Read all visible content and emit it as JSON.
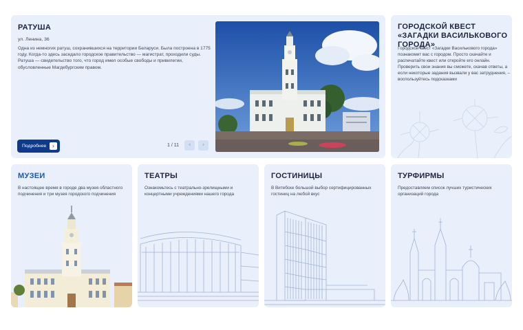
{
  "hero": {
    "title": "РАТУША",
    "address": "ул. Ленина, 36",
    "description": "Одна из немногих ратуш, сохранившихся на территории Беларуси. Была построена в 1775 году. Когда-то здесь заседало городское правительство — магистрат, проходили суды. Ратуша — свидетельство того, что город имел особые свободы и привилегии, обусловленные Магдебургским правом.",
    "more_label": "Подробнее",
    "more_icon": "arrow-right-icon",
    "pager": "1 / 11",
    "prev_icon": "chevron-left-icon",
    "next_icon": "chevron-right-icon"
  },
  "quest": {
    "title": "ГОРОДСКОЙ КВЕСТ «ЗАГАДКИ ВАСИЛЬКОВОГО ГОРОДА»",
    "description": "Городской квест «Загадки Василькового города» познакомит вас с городом. Просто скачайте и распечатайте квест или откройте его онлайн. Проверить свои знания вы сможете, скачав ответы, а если некоторые задания вызвали у вас затруднения, – воспользуйтесь подсказками"
  },
  "cards": {
    "museums": {
      "title": "МУЗЕИ",
      "description": "В настоящее время в городе два музея областного подчинения и три музея городского подчинения"
    },
    "theatres": {
      "title": "ТЕАТРЫ",
      "description": "Ознакомьтесь с театрально-зрелищными и концертными учреждениями нашего города"
    },
    "hotels": {
      "title": "ГОСТИНИЦЫ",
      "description": "В Витебске большой выбор сертифицированных гостиниц на любой вкус"
    },
    "tours": {
      "title": "ТУРФИРМЫ",
      "description": "Предоставляем список лучших туристических организаций города"
    }
  },
  "colors": {
    "card_bg": "#e9f0fb",
    "button_bg": "#0f3a8c",
    "accent_title": "#1a56b8",
    "line_art": "#9fb2d3"
  }
}
